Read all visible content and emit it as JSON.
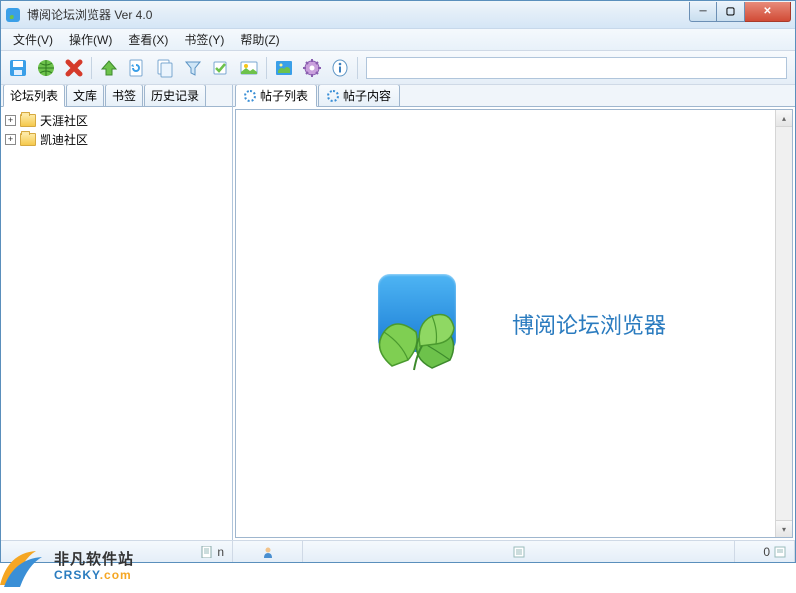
{
  "window": {
    "title": "博阅论坛浏览器 Ver 4.0"
  },
  "menu": {
    "items": [
      "文件(V)",
      "操作(W)",
      "查看(X)",
      "书签(Y)",
      "帮助(Z)"
    ]
  },
  "toolbar": {
    "search_value": ""
  },
  "left_panel": {
    "tabs": [
      "论坛列表",
      "文库",
      "书签",
      "历史记录"
    ],
    "active_tab": 0,
    "tree": [
      {
        "label": "天涯社区"
      },
      {
        "label": "凯迪社区"
      }
    ]
  },
  "right_panel": {
    "tabs": [
      "帖子列表",
      "帖子内容"
    ],
    "active_tab": 0,
    "app_name": "博阅论坛浏览器"
  },
  "statusbar": {
    "cell_n": "n",
    "cell_zero": "0"
  },
  "watermark": {
    "cn": "非凡软件站",
    "en_main": "CRSKY",
    "en_suffix": ".com"
  }
}
